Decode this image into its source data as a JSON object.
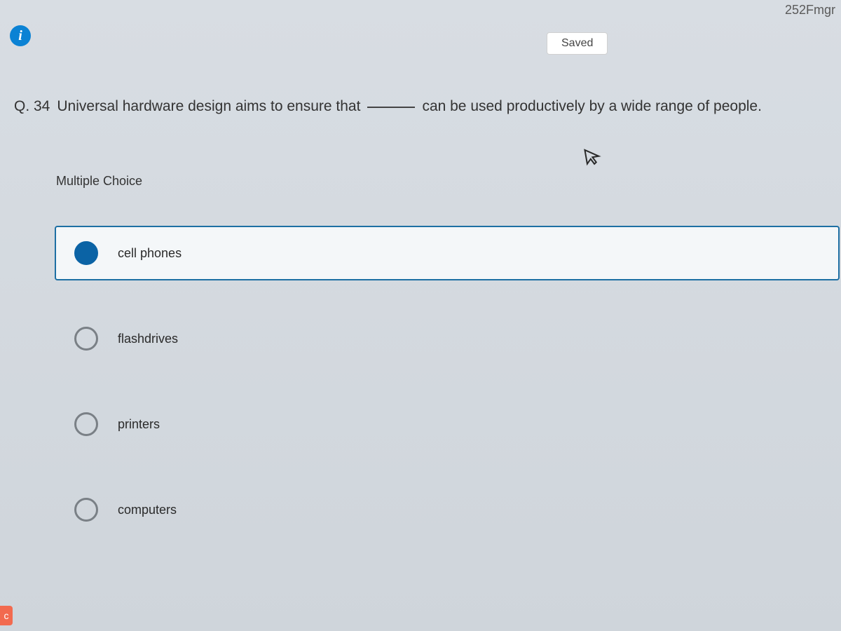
{
  "url_fragment": "252Fmgr",
  "status": {
    "saved": "Saved"
  },
  "info_icon_glyph": "i",
  "question": {
    "number_prefix": "Q. 34",
    "text_before": "Universal hardware design aims to ensure that",
    "text_after": "can be used productively by a wide range of people."
  },
  "mc_label": "Multiple Choice",
  "options": [
    {
      "label": "cell phones",
      "selected": true
    },
    {
      "label": "flashdrives",
      "selected": false
    },
    {
      "label": "printers",
      "selected": false
    },
    {
      "label": "computers",
      "selected": false
    }
  ],
  "cursor_glyph": "↖",
  "bottom_badge": "c"
}
